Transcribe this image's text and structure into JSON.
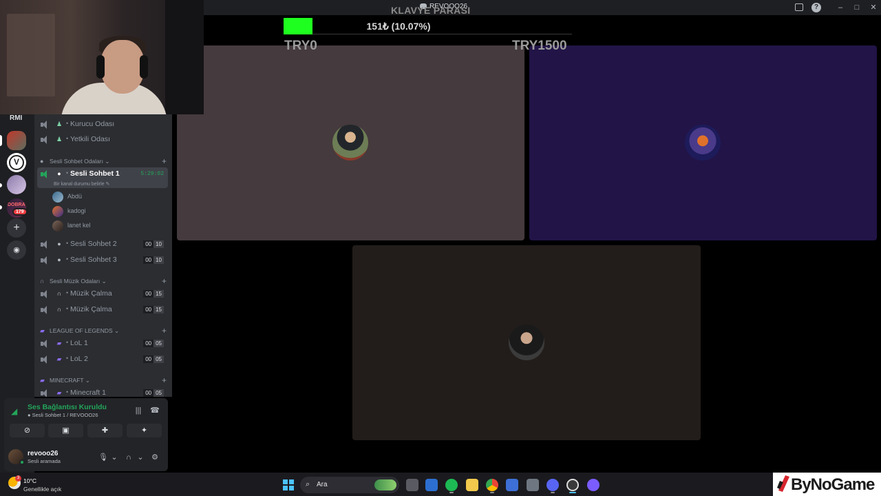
{
  "window": {
    "title": "REVOOO26"
  },
  "overlay": {
    "title": "KLAVYE PARASI",
    "amount_text": "151₺ (10.07%)",
    "progress": 0.1007,
    "min_label": "TRY0",
    "max_label": "TRY1500",
    "fill_color": "#1fff1f"
  },
  "server_rail": {
    "label": "RMI",
    "badge": "179",
    "server4_text": "DOBRA"
  },
  "channels": {
    "top": [
      {
        "name": "Kurucu Odası"
      },
      {
        "name": "Yetkili Odası"
      }
    ],
    "cat_voice": "Sesli Sohbet Odaları",
    "active": {
      "name": "Sesli Sohbet 1",
      "timer": "5:29:02",
      "status": "Bir kanal durumu belirle"
    },
    "users": [
      {
        "name": "Abdü"
      },
      {
        "name": "kadogi"
      },
      {
        "name": "lanet kel"
      }
    ],
    "voice_rest": [
      {
        "name": "Sesli Sohbet 2",
        "count": "00",
        "limit": "10"
      },
      {
        "name": "Sesli Sohbet 3",
        "count": "00",
        "limit": "10"
      }
    ],
    "cat_music": "Sesli Müzik Odaları",
    "music": [
      {
        "name": "Müzik Çalma",
        "count": "00",
        "limit": "15"
      },
      {
        "name": "Müzik Çalma",
        "count": "00",
        "limit": "15"
      }
    ],
    "cat_lol": "LEAGUE OF LEGENDS",
    "lol": [
      {
        "name": "LoL 1",
        "count": "00",
        "limit": "05"
      },
      {
        "name": "LoL 2",
        "count": "00",
        "limit": "05"
      }
    ],
    "cat_mc": "MINECRAFT",
    "mc": [
      {
        "name": "Minecraft 1",
        "count": "00",
        "limit": "05"
      }
    ]
  },
  "voice_panel": {
    "title": "Ses Bağlantısı Kuruldu",
    "subtitle": "Sesli Sohbet 1 / REVOOO26",
    "username": "revooo26",
    "user_status": "Sesli aramada"
  },
  "taskbar": {
    "temperature": "10°C",
    "weather": "Genellikle açık",
    "weather_badge": "3",
    "search_placeholder": "Ara",
    "watermark": "ByNoGame"
  }
}
